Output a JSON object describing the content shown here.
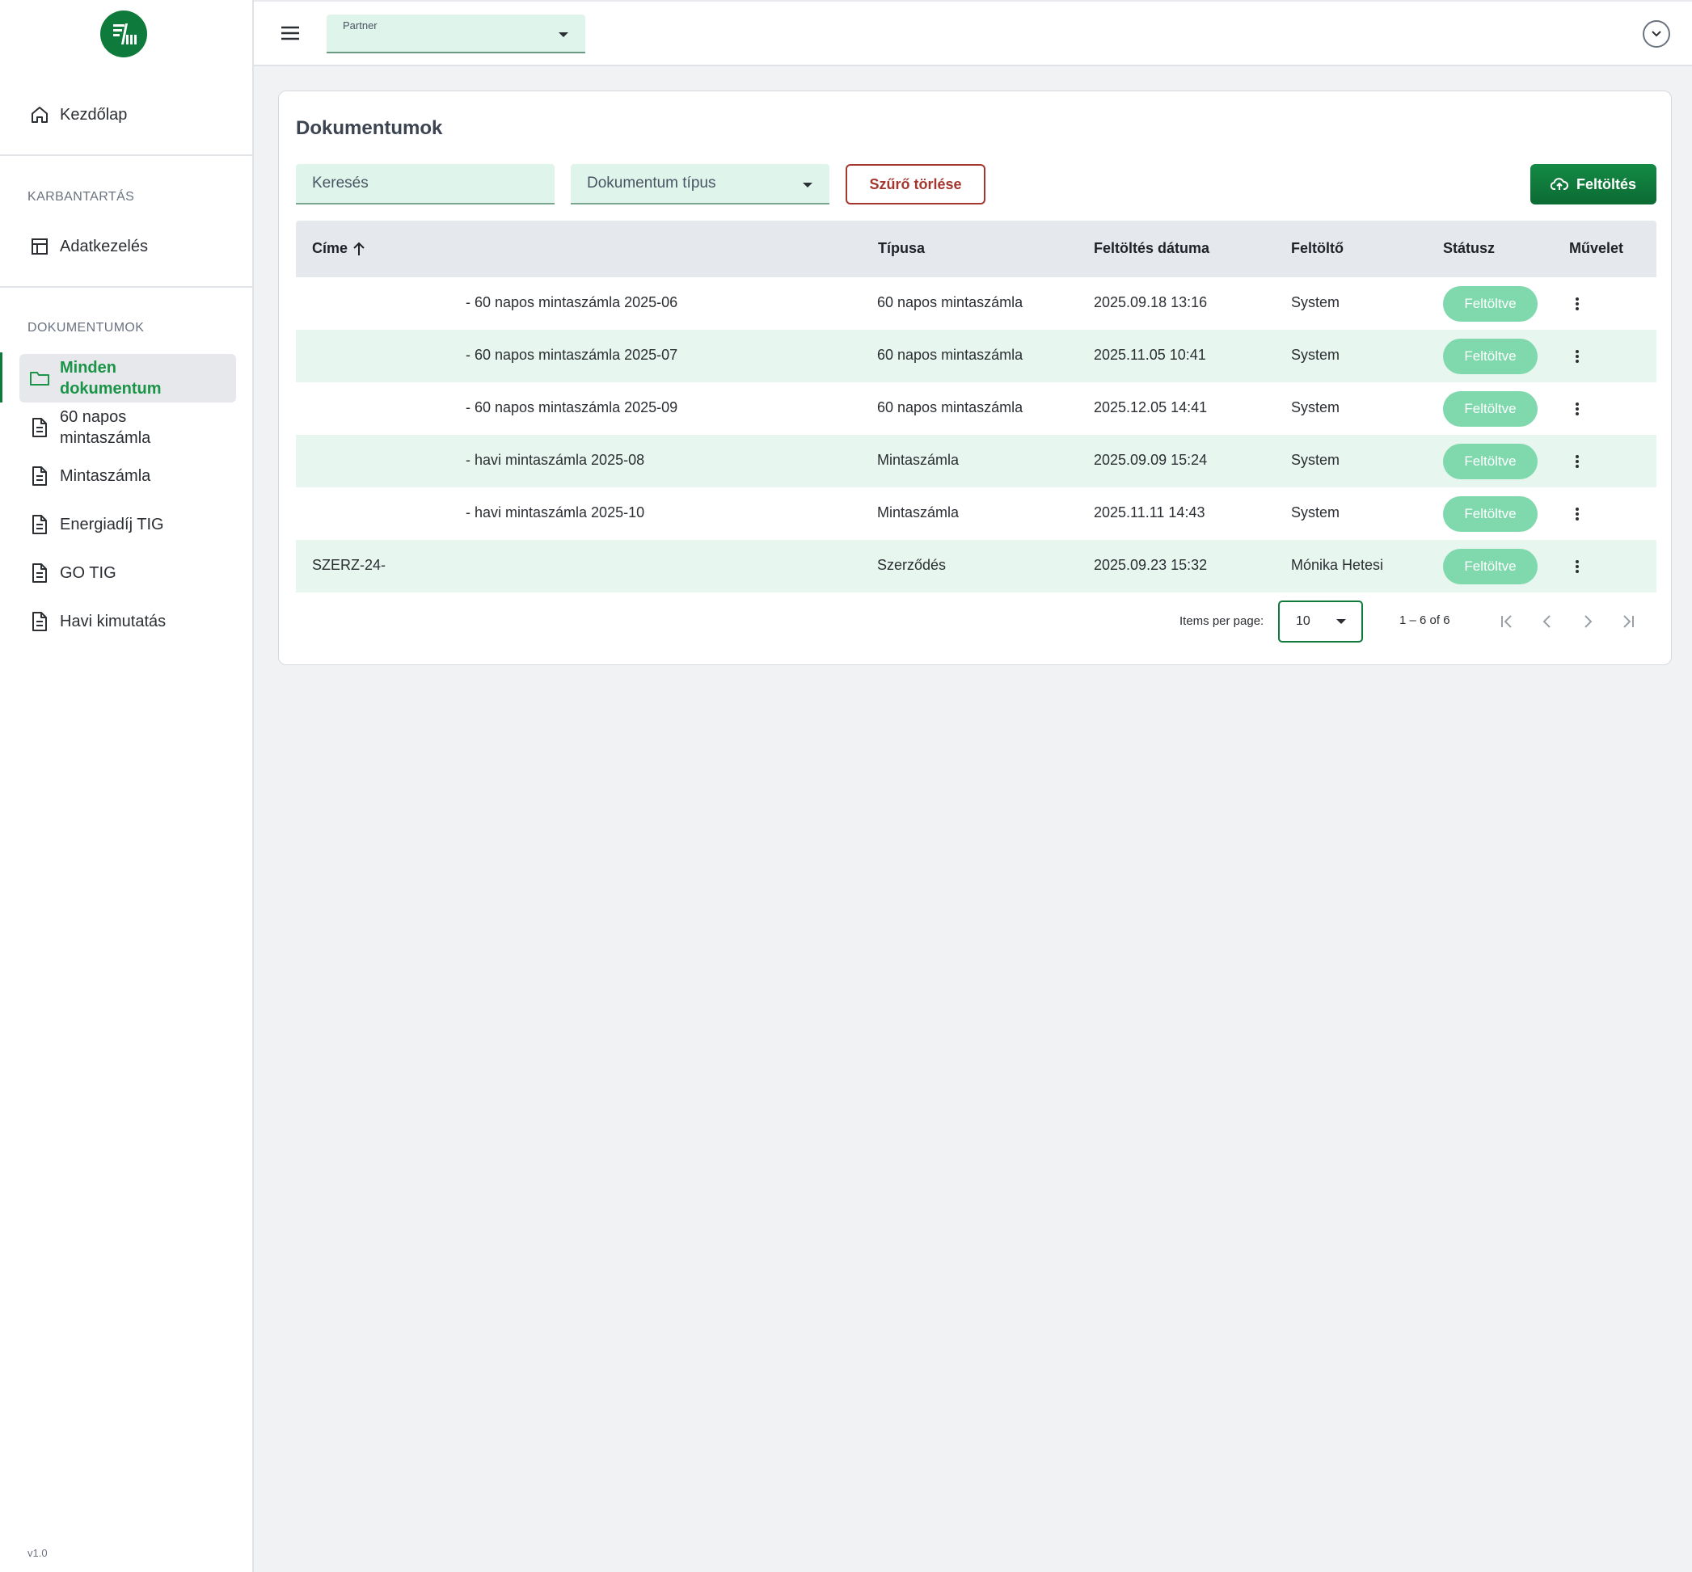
{
  "app": {
    "version": "v1.0"
  },
  "sidebar": {
    "home": {
      "label": "Kezdőlap",
      "icon": "home-icon"
    },
    "sections": [
      {
        "title": "KARBANTARTÁS",
        "items": [
          {
            "label": "Adatkezelés",
            "icon": "table-icon"
          }
        ]
      },
      {
        "title": "DOKUMENTUMOK",
        "items": [
          {
            "label": "Minden dokumentum",
            "icon": "folder-icon",
            "active": true
          },
          {
            "label": "60 napos mintaszámla",
            "icon": "document-icon"
          },
          {
            "label": "Mintaszámla",
            "icon": "document-icon"
          },
          {
            "label": "Energiadíj TIG",
            "icon": "document-icon"
          },
          {
            "label": "GO TIG",
            "icon": "document-icon"
          },
          {
            "label": "Havi kimutatás",
            "icon": "document-icon"
          }
        ]
      }
    ]
  },
  "topbar": {
    "partner_label": "Partner",
    "partner_value": ""
  },
  "main": {
    "title": "Dokumentumok",
    "search_placeholder": "Keresés",
    "type_filter": "Dokumentum típus",
    "clear_filter": "Szűrő törlése",
    "upload": "Feltöltés",
    "table": {
      "columns": [
        "Címe",
        "Típusa",
        "Feltöltés dátuma",
        "Feltöltő",
        "Státusz",
        "Művelet"
      ],
      "sort": {
        "column": "Címe",
        "direction": "asc"
      },
      "rows": [
        {
          "title": "- 60 napos mintaszámla 2025-06",
          "type": "60 napos mintaszámla",
          "date": "2025.09.18 13:16",
          "uploader": "System",
          "status": "Feltöltve"
        },
        {
          "title": "- 60 napos mintaszámla 2025-07",
          "type": "60 napos mintaszámla",
          "date": "2025.11.05 10:41",
          "uploader": "System",
          "status": "Feltöltve"
        },
        {
          "title": "- 60 napos mintaszámla 2025-09",
          "type": "60 napos mintaszámla",
          "date": "2025.12.05 14:41",
          "uploader": "System",
          "status": "Feltöltve"
        },
        {
          "title": "- havi mintaszámla 2025-08",
          "type": "Mintaszámla",
          "date": "2025.09.09 15:24",
          "uploader": "System",
          "status": "Feltöltve"
        },
        {
          "title": "- havi mintaszámla 2025-10",
          "type": "Mintaszámla",
          "date": "2025.11.11 14:43",
          "uploader": "System",
          "status": "Feltöltve"
        },
        {
          "title": "SZERZ-24-",
          "type": "Szerződés",
          "date": "2025.09.23 15:32",
          "uploader": "Mónika Hetesi",
          "status": "Feltöltve"
        }
      ]
    },
    "paginator": {
      "items_per_page_label": "Items per page:",
      "page_size": "10",
      "range": "1 – 6 of 6"
    }
  },
  "colors": {
    "brand": "#0e7a3b",
    "active_text": "#1a9447",
    "status_pill": "#7fd9ad",
    "clear_filter": "#a3372f",
    "row_alt": "#e7f6ee"
  }
}
